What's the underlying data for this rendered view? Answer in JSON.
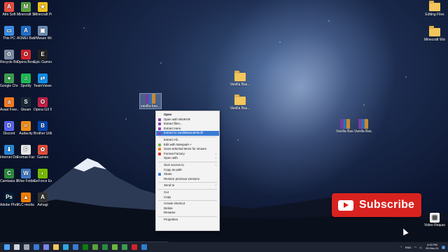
{
  "desktop": {
    "left_icons": [
      {
        "name": "Athi Soft",
        "color": "#e84d3d",
        "glyph": "A"
      },
      {
        "name": "Minecraft Server",
        "color": "#5aa33b",
        "glyph": "M"
      },
      {
        "name": "Minecraft Pure Vanilla",
        "color": "#f2c11b",
        "glyph": "★"
      },
      {
        "name": "This PC",
        "color": "#3a8ee6",
        "glyph": "▭"
      },
      {
        "name": "AOMEI Backupper",
        "color": "#1f6fc9",
        "glyph": "A"
      },
      {
        "name": "VMware Workstati...",
        "color": "#6c8fb4",
        "glyph": "▣"
      },
      {
        "name": "Recycle Bin",
        "color": "#7c8ca3",
        "glyph": "♲"
      },
      {
        "name": "Opera Browser",
        "color": "#d2232a",
        "glyph": "O"
      },
      {
        "name": "Epic Games Launcher",
        "color": "#222222",
        "glyph": "E"
      },
      {
        "name": "Google Chrome",
        "color": "#3b9c4e",
        "glyph": "●"
      },
      {
        "name": "Spotify",
        "color": "#1db954",
        "glyph": "♫"
      },
      {
        "name": "TeamViewer",
        "color": "#0e8ee9",
        "glyph": "⇄"
      },
      {
        "name": "Avast Free Antiviru...",
        "color": "#f47920",
        "glyph": "a"
      },
      {
        "name": "Steam",
        "color": "#1b2838",
        "glyph": "S"
      },
      {
        "name": "Opera GX Browser",
        "color": "#c21f44",
        "glyph": "O"
      },
      {
        "name": "Discord",
        "color": "#5865f2",
        "glyph": "D"
      },
      {
        "name": "Audacity",
        "color": "#f08c1a",
        "glyph": "≈"
      },
      {
        "name": "Brother Utilities",
        "color": "#0046ad",
        "glyph": "B"
      },
      {
        "name": "Internet Downlo...",
        "color": "#2a86d5",
        "glyph": "⬇"
      },
      {
        "name": "Format Factory",
        "color": "#e5e5e5",
        "glyph": "F"
      },
      {
        "name": "Games",
        "color": "#e24c3a",
        "glyph": "✿"
      },
      {
        "name": "Camtasia 2021",
        "color": "#2b8a3e",
        "glyph": "C"
      },
      {
        "name": "Wise Folder Hider",
        "color": "#3d79c4",
        "glyph": "W"
      },
      {
        "name": "GeForce Experience",
        "color": "#76b900",
        "glyph": "◐"
      },
      {
        "name": "Adobe Photosh...",
        "color": "#001e36",
        "glyph": "Ps"
      },
      {
        "name": "VLC media player",
        "color": "#f07d00",
        "glyph": "▲"
      },
      {
        "name": "Ashagi",
        "color": "#333333",
        "glyph": "A"
      }
    ],
    "right_icons": [
      {
        "name": "Editing Files"
      },
      {
        "name": "Minecraft Worlds ..."
      },
      {
        "name": "Video Requests"
      }
    ],
    "center_folders": [
      {
        "name": "Vanilla Bas..."
      },
      {
        "name": "Vanilla Bas..."
      }
    ],
    "rar_files": [
      {
        "name": "Vanilla Bas..."
      },
      {
        "name": "Vanilla Bas..."
      }
    ],
    "selected_file": {
      "name": "vanilla-bas..."
    }
  },
  "context_menu": {
    "items": [
      {
        "type": "item",
        "label": "Open",
        "bold": true
      },
      {
        "type": "item",
        "label": "Open with WinRAR",
        "icon": "#8a3fb0"
      },
      {
        "type": "item",
        "label": "Extract files...",
        "icon": "#8a3fb0"
      },
      {
        "type": "item",
        "label": "Extract Here",
        "icon": "#8a3fb0"
      },
      {
        "type": "item",
        "label": "Extract to vanillabasedefault\\",
        "icon": "#8a3fb0",
        "highlight": true
      },
      {
        "type": "sep"
      },
      {
        "type": "item",
        "label": "Extract All..."
      },
      {
        "type": "item",
        "label": "Edit with Notepad++",
        "icon": "#6cb33f"
      },
      {
        "type": "item",
        "label": "Scan selected items for viruses",
        "icon": "#f47920"
      },
      {
        "type": "item",
        "label": "Format Factory",
        "icon": "#d33",
        "arrow": true
      },
      {
        "type": "item",
        "label": "Open with",
        "arrow": true
      },
      {
        "type": "sep"
      },
      {
        "type": "item",
        "label": "Give access to",
        "arrow": true
      },
      {
        "type": "item",
        "label": "Copy as path"
      },
      {
        "type": "item",
        "label": "Share",
        "icon": "#3a7bd5"
      },
      {
        "type": "item",
        "label": "Restore previous versions"
      },
      {
        "type": "sep"
      },
      {
        "type": "item",
        "label": "Send to",
        "arrow": true
      },
      {
        "type": "sep"
      },
      {
        "type": "item",
        "label": "Cut"
      },
      {
        "type": "item",
        "label": "Copy"
      },
      {
        "type": "sep"
      },
      {
        "type": "item",
        "label": "Create shortcut"
      },
      {
        "type": "item",
        "label": "Delete"
      },
      {
        "type": "item",
        "label": "Rename"
      },
      {
        "type": "sep"
      },
      {
        "type": "item",
        "label": "Properties"
      }
    ]
  },
  "subscribe": {
    "label": "Subscribe"
  },
  "taskbar": {
    "apps": [
      {
        "name": "start",
        "color": "#4aa3ff"
      },
      {
        "name": "search",
        "color": "#cfd6e2"
      },
      {
        "name": "task-view",
        "color": "#9aa6b8"
      },
      {
        "name": "widgets",
        "color": "#3a7bd5"
      },
      {
        "name": "chat",
        "color": "#7b83eb"
      },
      {
        "name": "file-explorer",
        "color": "#f2c65a"
      },
      {
        "name": "edge",
        "color": "#2ea7dd"
      },
      {
        "name": "store",
        "color": "#3a7bd5"
      },
      {
        "name": "xbox",
        "color": "#107c10"
      },
      {
        "name": "minecraft",
        "color": "#5aa33b"
      },
      {
        "name": "camtasia",
        "color": "#2b8a3e"
      },
      {
        "name": "notepad",
        "color": "#6cb33f"
      },
      {
        "name": "chrome",
        "color": "#3b9c4e"
      },
      {
        "name": "opera",
        "color": "#d2232a"
      },
      {
        "name": "photos",
        "color": "#2f7dd1"
      }
    ],
    "tray": {
      "language": "ENG",
      "clock_time": "4:33 PM",
      "clock_date": "29-Nov-21",
      "badge": "1"
    }
  }
}
